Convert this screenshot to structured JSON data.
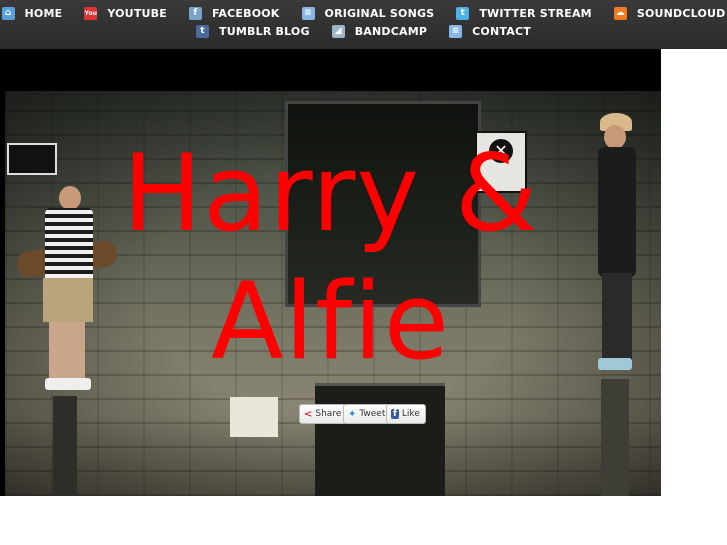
{
  "nav": {
    "row1": [
      {
        "label": "HOME",
        "icon": "home-icon",
        "glyph": "⌂"
      },
      {
        "label": "YOUTUBE",
        "icon": "youtube-icon",
        "glyph": "You"
      },
      {
        "label": "FACEBOOK",
        "icon": "facebook-icon",
        "glyph": "f"
      },
      {
        "label": "ORIGINAL SONGS",
        "icon": "document-icon",
        "glyph": "≡"
      },
      {
        "label": "TWITTER STREAM",
        "icon": "twitter-icon",
        "glyph": "t"
      },
      {
        "label": "SOUNDCLOUD",
        "icon": "soundcloud-icon",
        "glyph": "☁"
      }
    ],
    "row2": [
      {
        "label": "TUMBLR BLOG",
        "icon": "tumblr-icon",
        "glyph": "t"
      },
      {
        "label": "BANDCAMP",
        "icon": "bandcamp-icon",
        "glyph": "◢"
      },
      {
        "label": "CONTACT",
        "icon": "document-icon",
        "glyph": "≡"
      }
    ]
  },
  "hero": {
    "title_line1": "Harry &",
    "title_line2": "Alfie",
    "title_color": "#ff0000"
  },
  "social": {
    "share": "Share",
    "tweet": "Tweet",
    "like": "Like"
  },
  "colors": {
    "nav_bg": "#2f2f2f",
    "nav_text": "#ffffff",
    "hero_bg": "#000000"
  }
}
